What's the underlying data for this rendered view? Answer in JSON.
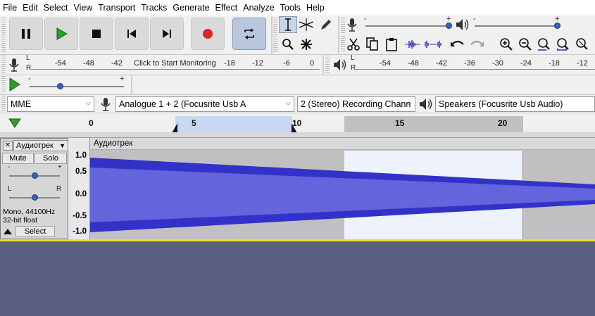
{
  "menu": [
    "File",
    "Edit",
    "Select",
    "View",
    "Transport",
    "Tracks",
    "Generate",
    "Effect",
    "Analyze",
    "Tools",
    "Help"
  ],
  "record_meter": {
    "scale": [
      "-54",
      "-48",
      "-42",
      "-18",
      "-12",
      "-6",
      "0"
    ],
    "prompt": "Click to Start Monitoring",
    "channels": [
      "L",
      "R"
    ]
  },
  "play_meter": {
    "scale": [
      "-54",
      "-48",
      "-42",
      "-36",
      "-30",
      "-24",
      "-18",
      "-12"
    ],
    "channels": [
      "L",
      "R"
    ]
  },
  "play_speed": {
    "min_label": "-",
    "max_label": "+"
  },
  "mixer": {
    "min_label": "-",
    "max_label": "+"
  },
  "devices": {
    "host": "MME",
    "recording_device": "Analogue 1 + 2 (Focusrite Usb A",
    "channels": "2 (Stereo) Recording Chann",
    "playback_device": "Speakers (Focusrite Usb Audio)"
  },
  "timeline": {
    "marks": [
      "0",
      "5",
      "10",
      "15",
      "20"
    ]
  },
  "track": {
    "name": "Аудиотрек",
    "clip_name": "Аудиотрек",
    "mute_label": "Mute",
    "solo_label": "Solo",
    "gain_min": "-",
    "gain_max": "+",
    "pan_left": "L",
    "pan_right": "R",
    "info_line1": "Mono, 44100Hz",
    "info_line2": "32-bit float",
    "select_label": "Select",
    "close_glyph": "✕",
    "menu_glyph": "▼",
    "scale": [
      "1.0",
      "0.5",
      "0.0",
      "-0.5",
      "-1.0"
    ]
  },
  "colors": {
    "waveform": "#3232c8",
    "waveform_rms": "#6464dc",
    "selection": "#eef2fc",
    "record": "#e0242a",
    "play": "#2aa02a"
  }
}
